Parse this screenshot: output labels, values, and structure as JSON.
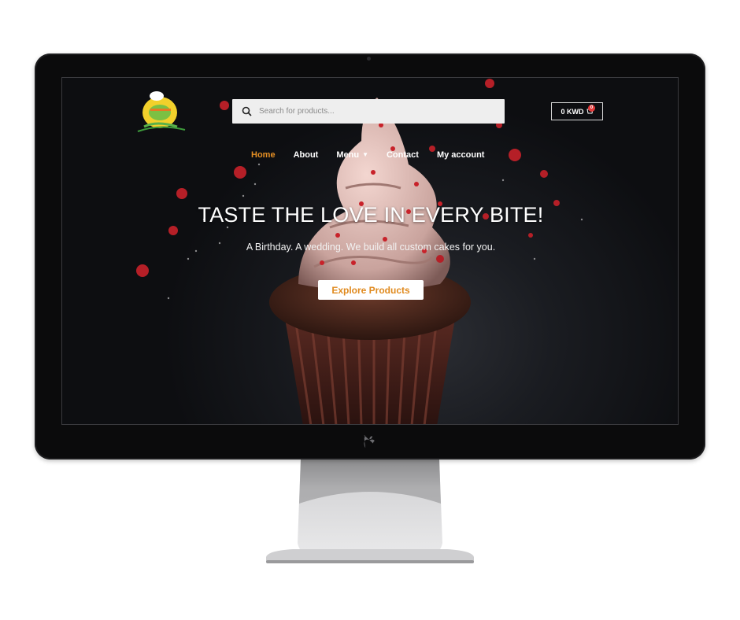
{
  "header": {
    "search_placeholder": "Search for products...",
    "cart_total": "0 KWD",
    "cart_count": "0"
  },
  "nav": {
    "items": [
      {
        "label": "Home",
        "active": true
      },
      {
        "label": "About"
      },
      {
        "label": "Menu"
      },
      {
        "label": "Contact"
      },
      {
        "label": "My account"
      }
    ]
  },
  "hero": {
    "title": "TASTE THE LOVE IN EVERY BITE!",
    "subtitle": "A Birthday. A wedding. We build all custom cakes for you.",
    "cta_label": "Explore Products"
  },
  "colors": {
    "accent": "#e69024",
    "cta_text": "#e08a1e",
    "badge": "#e23b3b",
    "background": "#0d0e11"
  },
  "icons": [
    "search-icon",
    "cart-icon",
    "chevron-down-icon",
    "apple-logo-icon"
  ]
}
